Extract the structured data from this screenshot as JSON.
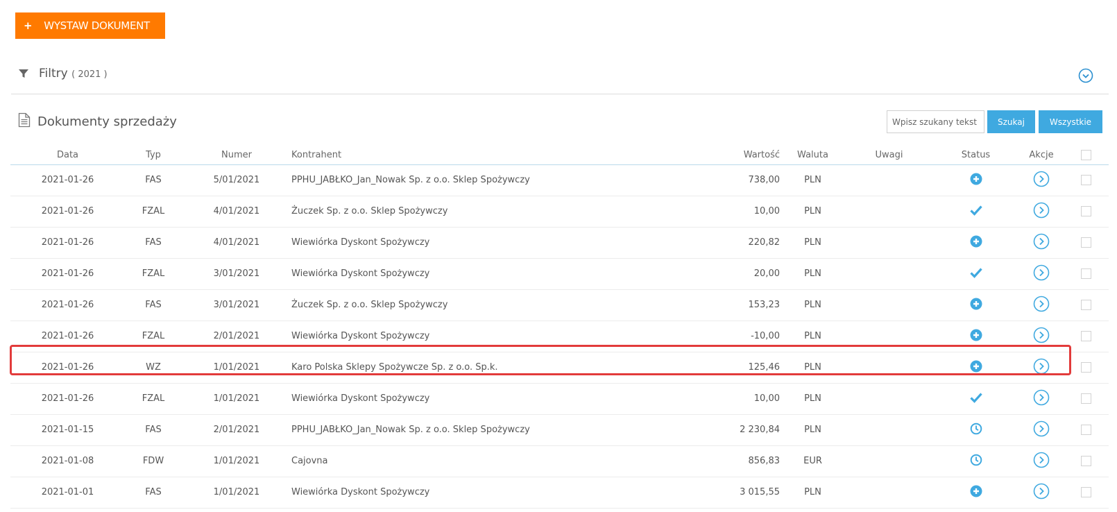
{
  "toolbar": {
    "new_doc_icon": "+",
    "new_doc_label": "WYSTAW DOKUMENT"
  },
  "filters": {
    "label": "Filtry",
    "year": "( 2021 )",
    "icon": "funnel-icon",
    "toggle_icon": "chevron-down-circle-icon"
  },
  "section": {
    "title": "Dokumenty sprzedaży",
    "icon": "document-icon"
  },
  "search": {
    "placeholder": "Wpisz szukany tekst",
    "value": "",
    "search_label": "Szukaj",
    "all_label": "Wszystkie"
  },
  "table": {
    "headers": {
      "date": "Data",
      "type": "Typ",
      "number": "Numer",
      "contractor": "Kontrahent",
      "value": "Wartość",
      "currency": "Waluta",
      "notes": "Uwagi",
      "status": "Status",
      "actions": "Akcje"
    },
    "rows": [
      {
        "date": "2021-01-26",
        "type": "FAS",
        "number": "5/01/2021",
        "contractor": "PPHU_JABŁKO_Jan_Nowak Sp. z o.o. Sklep Spożywczy",
        "value": "738,00",
        "currency": "PLN",
        "notes": "",
        "status": "plus"
      },
      {
        "date": "2021-01-26",
        "type": "FZAL",
        "number": "4/01/2021",
        "contractor": "Żuczek Sp. z o.o. Sklep Spożywczy",
        "value": "10,00",
        "currency": "PLN",
        "notes": "",
        "status": "check"
      },
      {
        "date": "2021-01-26",
        "type": "FAS",
        "number": "4/01/2021",
        "contractor": "Wiewiórka Dyskont Spożywczy",
        "value": "220,82",
        "currency": "PLN",
        "notes": "",
        "status": "plus"
      },
      {
        "date": "2021-01-26",
        "type": "FZAL",
        "number": "3/01/2021",
        "contractor": "Wiewiórka Dyskont Spożywczy",
        "value": "20,00",
        "currency": "PLN",
        "notes": "",
        "status": "check"
      },
      {
        "date": "2021-01-26",
        "type": "FAS",
        "number": "3/01/2021",
        "contractor": "Żuczek Sp. z o.o. Sklep Spożywczy",
        "value": "153,23",
        "currency": "PLN",
        "notes": "",
        "status": "plus"
      },
      {
        "date": "2021-01-26",
        "type": "FZAL",
        "number": "2/01/2021",
        "contractor": "Wiewiórka Dyskont Spożywczy",
        "value": "-10,00",
        "currency": "PLN",
        "notes": "",
        "status": "plus"
      },
      {
        "date": "2021-01-26",
        "type": "WZ",
        "number": "1/01/2021",
        "contractor": "Karo Polska Sklepy Spożywcze Sp. z o.o. Sp.k.",
        "value": "125,46",
        "currency": "PLN",
        "notes": "",
        "status": "plus",
        "highlighted": true
      },
      {
        "date": "2021-01-26",
        "type": "FZAL",
        "number": "1/01/2021",
        "contractor": "Wiewiórka Dyskont Spożywczy",
        "value": "10,00",
        "currency": "PLN",
        "notes": "",
        "status": "check"
      },
      {
        "date": "2021-01-15",
        "type": "FAS",
        "number": "2/01/2021",
        "contractor": "PPHU_JABŁKO_Jan_Nowak Sp. z o.o. Sklep Spożywczy",
        "value": "2 230,84",
        "currency": "PLN",
        "notes": "",
        "status": "clock"
      },
      {
        "date": "2021-01-08",
        "type": "FDW",
        "number": "1/01/2021",
        "contractor": "Cajovna",
        "value": "856,83",
        "currency": "EUR",
        "notes": "",
        "status": "clock"
      },
      {
        "date": "2021-01-01",
        "type": "FAS",
        "number": "1/01/2021",
        "contractor": "Wiewiórka Dyskont Spożywczy",
        "value": "3 015,55",
        "currency": "PLN",
        "notes": "",
        "status": "plus"
      }
    ]
  },
  "colors": {
    "accent_orange": "#ff7a00",
    "accent_blue": "#3fa9e0",
    "highlight_red": "#e23b3b"
  }
}
